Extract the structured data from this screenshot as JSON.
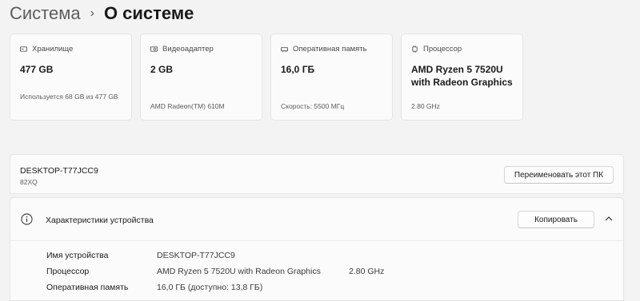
{
  "breadcrumb": {
    "parent": "Система",
    "separator": "›",
    "current": "О системе"
  },
  "cards": [
    {
      "icon": "storage-icon",
      "label": "Хранилище",
      "value": "477 GB",
      "sub": "Используется 68 GB из 477 GB"
    },
    {
      "icon": "gpu-icon",
      "label": "Видеоадаптер",
      "value": "2 GB",
      "sub": "AMD Radeon(TM) 610M"
    },
    {
      "icon": "ram-icon",
      "label": "Оперативная память",
      "value": "16,0 ГБ",
      "sub": "Скорость: 5500 МГц"
    },
    {
      "icon": "cpu-icon",
      "label": "Процессор",
      "value": "AMD Ryzen 5 7520U with Radeon Graphics",
      "sub": "2.80 GHz"
    }
  ],
  "device": {
    "name": "DESKTOP-T77JCC9",
    "model": "82XQ",
    "rename_label": "Переименовать этот ПК"
  },
  "specs": {
    "title": "Характеристики устройства",
    "copy_label": "Копировать",
    "rows": [
      {
        "label": "Имя устройства",
        "value": "DESKTOP-T77JCC9",
        "extra": ""
      },
      {
        "label": "Процессор",
        "value": "AMD Ryzen 5 7520U with Radeon Graphics",
        "extra": "2.80 GHz"
      },
      {
        "label": "Оперативная память",
        "value": "16,0 ГБ (доступно: 13,8 ГБ)",
        "extra": ""
      }
    ]
  }
}
